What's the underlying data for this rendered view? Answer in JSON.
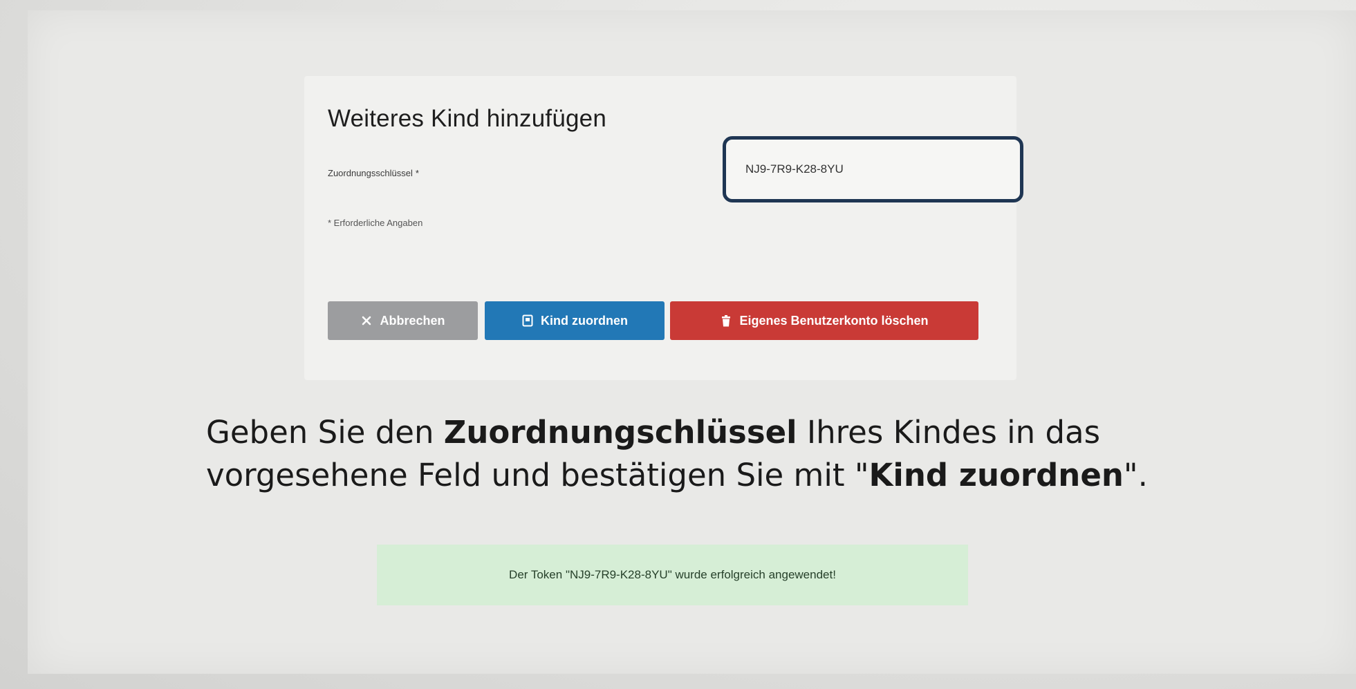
{
  "form": {
    "title": "Weiteres Kind hinzufügen",
    "field_label": "Zuordnungsschlüssel",
    "required_marker": "*",
    "token_value": "NJ9-7R9-K28-8YU",
    "required_note": "* Erforderliche Angaben"
  },
  "buttons": {
    "cancel_label": "Abbrechen",
    "assign_label": "Kind zuordnen",
    "delete_label": "Eigenes Benutzerkonto löschen"
  },
  "caption": {
    "part1": "Geben Sie den ",
    "bold1": "Zuordnungschlüssel",
    "part2": " Ihres Kindes in das vorgesehene Feld und bestätigen Sie mit \"",
    "bold2": "Kind zuordnen",
    "part3": "\"."
  },
  "alert": {
    "message": "Der Token \"NJ9-7R9-K28-8YU\" wurde erfolgreich angewendet!"
  },
  "colors": {
    "cancel": "#9c9d9f",
    "assign": "#2278b6",
    "delete": "#c93a36",
    "success_bg": "#d6eed6",
    "input_border": "#1f3653"
  },
  "icons": {
    "cancel": "close-icon",
    "assign": "assign-icon",
    "delete": "trash-icon"
  }
}
